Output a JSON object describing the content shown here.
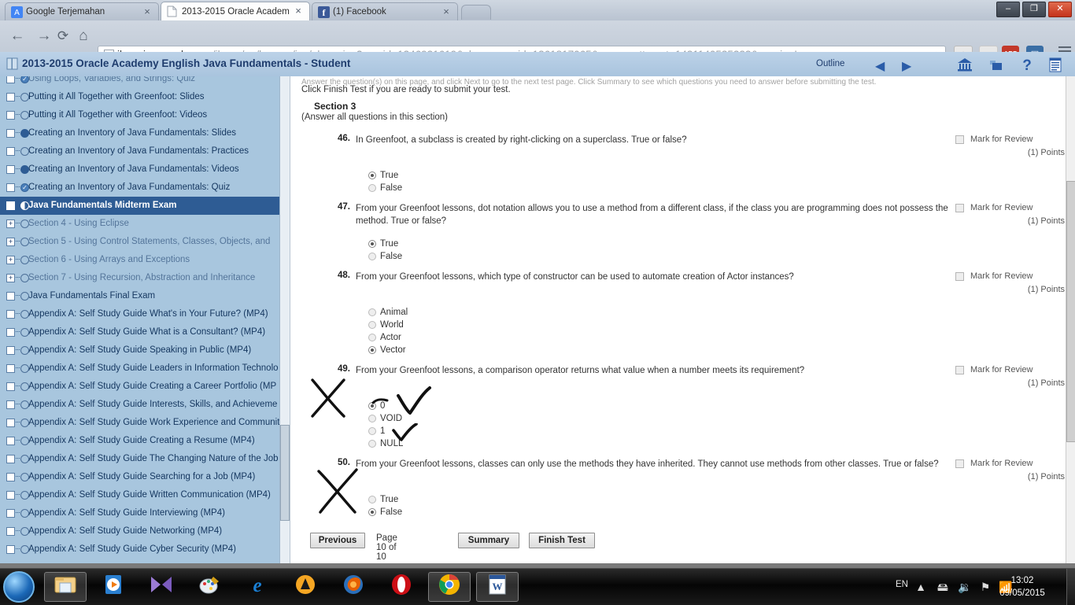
{
  "browser": {
    "tabs": [
      {
        "title": "Google Terjemahan",
        "favicon": "translate-icon",
        "active": false
      },
      {
        "title": "2013-2015 Oracle Academ",
        "favicon": "page-icon",
        "active": true
      },
      {
        "title": "(1) Facebook",
        "favicon": "facebook-icon",
        "active": false
      }
    ],
    "close_glyph": "×",
    "nav": {
      "back": "←",
      "forward": "→",
      "reload": "C",
      "home": "⌂"
    },
    "url_host": "ilearning.oracle.com",
    "url_path": "/ilearn/en/learner/jsp/player.jsp?rco_id=1346921619&classroom_id=1361817065&scorm_attempt=1431140535222&sessionI",
    "star_glyph": "☆",
    "extensions": [
      {
        "name": "page-action-icon",
        "label": "◉",
        "color": "#d8d8d8"
      },
      {
        "name": "stumbleupon-icon",
        "label": "S",
        "color": "#e04020"
      },
      {
        "name": "adblock-icon",
        "label": "ABP",
        "color": "#c03a28"
      },
      {
        "name": "app-icon",
        "label": "▣",
        "color": "#3a6ea5"
      }
    ],
    "window_buttons": [
      {
        "name": "minimize-button",
        "glyph": "–"
      },
      {
        "name": "maximize-button",
        "glyph": "❐"
      },
      {
        "name": "close-button",
        "glyph": "✕"
      }
    ]
  },
  "app_header": {
    "title": "2013-2015 Oracle Academy English Java Fundamentals - Student",
    "outline_label": "Outline",
    "prev_glyph": "◀",
    "next_glyph": "▶",
    "icons": [
      "home-icon",
      "notes-icon",
      "help-icon",
      "outline-list-icon"
    ]
  },
  "sidebar": {
    "items": [
      {
        "label": "Using Loops, Variables, and Strings: Quiz",
        "status": "check",
        "box": "leaf",
        "state": "dim",
        "clipped": true
      },
      {
        "label": "Putting it All Together with Greenfoot: Slides",
        "status": "empty",
        "box": "leaf",
        "state": "normal"
      },
      {
        "label": "Putting it All Together with Greenfoot: Videos",
        "status": "empty",
        "box": "leaf",
        "state": "normal"
      },
      {
        "label": "Creating an Inventory of Java Fundamentals: Slides",
        "status": "filled",
        "box": "leaf",
        "state": "normal"
      },
      {
        "label": "Creating an Inventory of Java Fundamentals: Practices",
        "status": "empty",
        "box": "leaf",
        "state": "normal"
      },
      {
        "label": "Creating an Inventory of Java Fundamentals: Videos",
        "status": "filled",
        "box": "leaf",
        "state": "normal"
      },
      {
        "label": "Creating an Inventory of Java Fundamentals: Quiz",
        "status": "check",
        "box": "leaf",
        "state": "normal"
      },
      {
        "label": "Java Fundamentals Midterm Exam",
        "status": "half",
        "box": "selected",
        "state": "selected"
      },
      {
        "label": "Section 4 - Using Eclipse",
        "status": "empty",
        "box": "expand",
        "state": "dim"
      },
      {
        "label": "Section 5 - Using Control Statements, Classes, Objects, and",
        "status": "empty",
        "box": "expand",
        "state": "dim"
      },
      {
        "label": "Section 6 - Using Arrays and Exceptions",
        "status": "empty",
        "box": "expand",
        "state": "dim"
      },
      {
        "label": "Section 7 - Using Recursion, Abstraction and Inheritance",
        "status": "empty",
        "box": "expand",
        "state": "dim"
      },
      {
        "label": "Java Fundamentals Final Exam",
        "status": "empty",
        "box": "leaf",
        "state": "normal"
      },
      {
        "label": "Appendix A: Self Study Guide What's in Your Future? (MP4)",
        "status": "empty",
        "box": "leaf",
        "state": "normal"
      },
      {
        "label": "Appendix A: Self Study Guide What is a Consultant? (MP4)",
        "status": "empty",
        "box": "leaf",
        "state": "normal"
      },
      {
        "label": "Appendix A: Self Study Guide Speaking in Public (MP4)",
        "status": "empty",
        "box": "leaf",
        "state": "normal"
      },
      {
        "label": "Appendix A: Self Study Guide Leaders in Information Technolo",
        "status": "empty",
        "box": "leaf",
        "state": "normal"
      },
      {
        "label": "Appendix A: Self Study Guide Creating a Career Portfolio (MP",
        "status": "empty",
        "box": "leaf",
        "state": "normal"
      },
      {
        "label": "Appendix A: Self Study Guide Interests, Skills, and Achieveme",
        "status": "empty",
        "box": "leaf",
        "state": "normal"
      },
      {
        "label": "Appendix A: Self Study Guide Work Experience and Communit",
        "status": "empty",
        "box": "leaf",
        "state": "normal"
      },
      {
        "label": "Appendix A: Self Study Guide Creating a Resume (MP4)",
        "status": "empty",
        "box": "leaf",
        "state": "normal"
      },
      {
        "label": "Appendix A: Self Study Guide The Changing Nature of the Job",
        "status": "empty",
        "box": "leaf",
        "state": "normal"
      },
      {
        "label": "Appendix A: Self Study Guide Searching for a Job (MP4)",
        "status": "empty",
        "box": "leaf",
        "state": "normal"
      },
      {
        "label": "Appendix A: Self Study Guide Written Communication (MP4)",
        "status": "empty",
        "box": "leaf",
        "state": "normal"
      },
      {
        "label": "Appendix A: Self Study Guide Interviewing (MP4)",
        "status": "empty",
        "box": "leaf",
        "state": "normal"
      },
      {
        "label": "Appendix A: Self Study Guide Networking (MP4)",
        "status": "empty",
        "box": "leaf",
        "state": "normal"
      },
      {
        "label": "Appendix A: Self Study Guide Cyber Security (MP4)",
        "status": "empty",
        "box": "leaf",
        "state": "normal"
      }
    ]
  },
  "test": {
    "instruction_clipped": "Answer the question(s) on this page, and click Next to go to the next test page. Click Summary to see which questions you need to answer before submitting the test.",
    "instruction_line": "Click Finish Test if you are ready to submit your test.",
    "section_title": "Section 3",
    "section_subtitle": "(Answer all questions in this section)",
    "mark_label": "Mark for Review",
    "points_label": "(1) Points",
    "questions": [
      {
        "number": "46.",
        "text": "In Greenfoot, a subclass is created by right-clicking on a superclass. True or false?",
        "options": [
          {
            "label": "True",
            "selected": true
          },
          {
            "label": "False",
            "selected": false
          }
        ],
        "annotation": null
      },
      {
        "number": "47.",
        "text": "From your Greenfoot lessons, dot notation allows you to use a method from a different class, if the class you are programming does not possess the method. True or false?",
        "options": [
          {
            "label": "True",
            "selected": true
          },
          {
            "label": "False",
            "selected": false
          }
        ],
        "annotation": null
      },
      {
        "number": "48.",
        "text": "From your Greenfoot lessons, which type of constructor can be used to automate creation of Actor instances?",
        "options": [
          {
            "label": "Animal",
            "selected": false
          },
          {
            "label": "World",
            "selected": false
          },
          {
            "label": "Actor",
            "selected": false
          },
          {
            "label": "Vector",
            "selected": true
          }
        ],
        "annotation": "handwritten-x-and-check"
      },
      {
        "number": "49.",
        "text": "From your Greenfoot lessons, a comparison operator returns what value when a number meets its requirement?",
        "options": [
          {
            "label": "0",
            "selected": true
          },
          {
            "label": "VOID",
            "selected": false
          },
          {
            "label": "1",
            "selected": false
          },
          {
            "label": "NULL",
            "selected": false
          }
        ],
        "annotation": "handwritten-x-and-check"
      },
      {
        "number": "50.",
        "text": "From your Greenfoot lessons, classes can only use the methods they have inherited. They cannot use methods from other classes. True or false?",
        "options": [
          {
            "label": "True",
            "selected": false
          },
          {
            "label": "False",
            "selected": true
          }
        ],
        "annotation": null
      }
    ],
    "footer": {
      "previous_label": "Previous",
      "page_indicator": "Page 10 of 10",
      "summary_label": "Summary",
      "finish_label": "Finish Test"
    }
  },
  "taskbar": {
    "start_name": "start-orb",
    "items": [
      {
        "name": "windows-explorer",
        "glyph": "🗂",
        "color": "#f0c674",
        "active": true
      },
      {
        "name": "media-player",
        "glyph": "▶",
        "color": "#3fa9f5",
        "active": false
      },
      {
        "name": "movie-maker",
        "glyph": "◀▶",
        "color": "#9b7bd4",
        "active": false
      },
      {
        "name": "paint",
        "glyph": "🎨",
        "color": "#e8e8e8",
        "active": false
      },
      {
        "name": "internet-explorer",
        "glyph": "e",
        "color": "#1a7fd4",
        "active": false
      },
      {
        "name": "avira-antivirus",
        "glyph": "▲",
        "color": "#f5a623",
        "active": false
      },
      {
        "name": "mozilla-firefox",
        "glyph": "🦊",
        "color": "#e66000",
        "active": false
      },
      {
        "name": "opera-browser",
        "glyph": "O",
        "color": "#cc0f16",
        "active": false
      },
      {
        "name": "google-chrome",
        "glyph": "●",
        "color": "#4285f4",
        "active": true
      },
      {
        "name": "microsoft-word",
        "glyph": "W",
        "color": "#2b579a",
        "active": true
      }
    ],
    "language": "EN",
    "tray_icons": [
      "show-hidden-icons",
      "removable-media-icon",
      "volume-icon",
      "action-center-icon",
      "network-icon"
    ],
    "time": "13:02",
    "date": "09/05/2015"
  }
}
